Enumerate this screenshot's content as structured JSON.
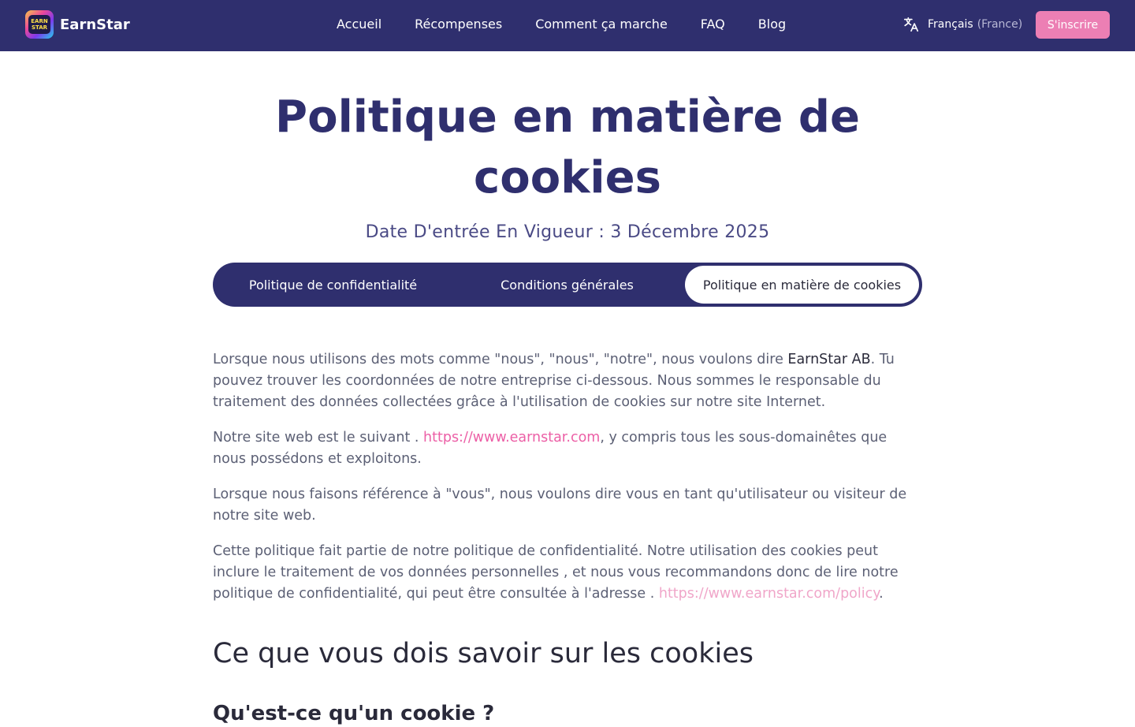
{
  "brand": {
    "name": "EarnStar",
    "logo_line1": "EARN",
    "logo_line2": "STAR"
  },
  "nav": [
    {
      "label": "Accueil"
    },
    {
      "label": "Récompenses"
    },
    {
      "label": "Comment ça marche"
    },
    {
      "label": "FAQ"
    },
    {
      "label": "Blog"
    }
  ],
  "language": {
    "label": "Français",
    "region": "(France)",
    "icon": "translate-icon"
  },
  "signup_label": "S'inscrire",
  "page": {
    "title": "Politique en matière de cookies",
    "effective_date": "Date D'entrée En Vigueur : 3 Décembre 2025"
  },
  "tabs": [
    {
      "label": "Politique de confidentialité",
      "active": false
    },
    {
      "label": "Conditions générales",
      "active": false
    },
    {
      "label": "Politique en matière de cookies",
      "active": true
    }
  ],
  "content": {
    "p1_before": "Lorsque nous utilisons des mots comme \"nous\", \"nous\", \"notre\", nous voulons dire ",
    "p1_company": "EarnStar AB",
    "p1_after": ". Tu pouvez trouver les coordonnées de notre entreprise ci-dessous. Nous sommes le responsable du traitement des données collectées grâce à l'utilisation de cookies sur notre site Internet.",
    "p2_before": "Notre site web est le suivant . ",
    "p2_link": "https://www.earnstar.com",
    "p2_after": ", y compris tous les sous-domainêtes que nous possédons et exploitons.",
    "p3": "Lorsque nous faisons référence à \"vous\", nous voulons dire vous en tant qu'utilisateur ou visiteur de notre site web.",
    "p4_before": "Cette politique fait partie de notre politique de confidentialité. Notre utilisation des cookies peut inclure le traitement de vos données personnelles , et nous vous recommandons donc de lire notre politique de confidentialité, qui peut être consultée à l'adresse . ",
    "p4_link": "https://www.earnstar.com/policy",
    "p4_after": "."
  },
  "section_heading": "Ce que vous dois savoir sur les cookies",
  "subsection_heading": "Qu'est-ce qu'un cookie ?",
  "colors": {
    "header_bg": "#2f2f6e",
    "accent_pink": "#ec7fb4",
    "link_pink": "#ec5fa6",
    "title_color": "#2f2f6e"
  }
}
